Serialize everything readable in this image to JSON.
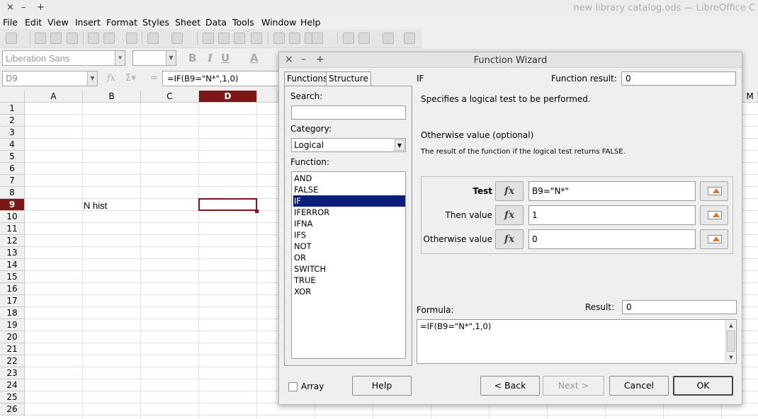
{
  "window": {
    "title": "new library catalog.ods — LibreOffice C",
    "controls": [
      "×",
      "–",
      "+"
    ]
  },
  "menubar": [
    "File",
    "Edit",
    "View",
    "Insert",
    "Format",
    "Styles",
    "Sheet",
    "Data",
    "Tools",
    "Window",
    "Help"
  ],
  "format_bar": {
    "font_name": "Liberation Sans",
    "font_size": "",
    "bold": "B",
    "italic": "I",
    "underline": "U",
    "font_color": "A"
  },
  "name_bar": {
    "cell_ref": "D9",
    "formula": "=IF(B9=\"N*\",1,0)"
  },
  "grid": {
    "columns": [
      "A",
      "B",
      "C",
      "D",
      "M"
    ],
    "selected_column": "D",
    "rows": [
      "1",
      "2",
      "3",
      "4",
      "5",
      "6",
      "7",
      "8",
      "9",
      "10",
      "11",
      "12",
      "13",
      "14",
      "15",
      "16",
      "17",
      "18",
      "19",
      "20",
      "21",
      "22",
      "23",
      "24",
      "25",
      "26"
    ],
    "selected_row": "9",
    "cells": {
      "B9": "N hist"
    }
  },
  "dialog": {
    "title": "Function Wizard",
    "controls": [
      "×",
      "–",
      "+"
    ],
    "tabs": [
      "Functions",
      "Structure"
    ],
    "search_label": "Search:",
    "search_value": "",
    "category_label": "Category:",
    "category_value": "Logical",
    "function_label": "Function:",
    "functions": [
      "AND",
      "FALSE",
      "IF",
      "IFERROR",
      "IFNA",
      "IFS",
      "NOT",
      "OR",
      "SWITCH",
      "TRUE",
      "XOR"
    ],
    "selected_function": "IF",
    "function_name": "IF",
    "function_result_label": "Function result:",
    "function_result_value": "0",
    "description": "Specifies a logical test to be performed.",
    "arg_title": "Otherwise value (optional)",
    "arg_description": "The result of the function if the logical test returns FALSE.",
    "fx_label": "fx",
    "arguments": [
      {
        "label": "Test",
        "value": "B9=\"N*\""
      },
      {
        "label": "Then value",
        "value": "1"
      },
      {
        "label": "Otherwise value",
        "value": "0"
      }
    ],
    "formula_label": "Formula:",
    "formula_value": "=IF(B9=\"N*\",1,0)",
    "result_label": "Result:",
    "result_value": "0",
    "array_label": "Array",
    "buttons": {
      "help": "Help",
      "back": "< Back",
      "next": "Next >",
      "cancel": "Cancel",
      "ok": "OK"
    }
  }
}
